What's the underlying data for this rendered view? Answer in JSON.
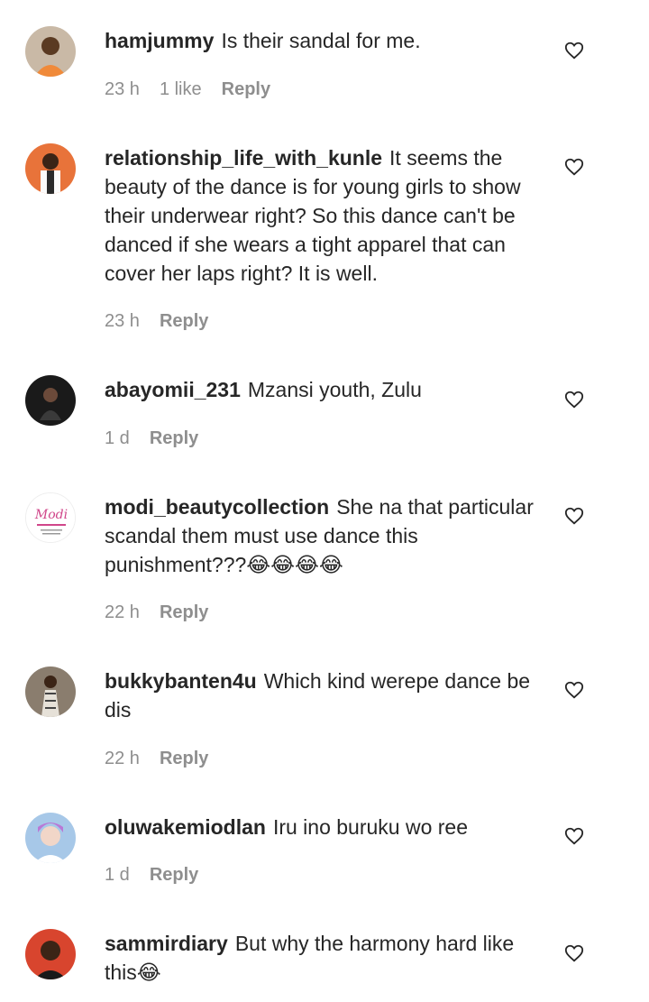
{
  "comments": [
    {
      "username": "hamjummy",
      "text": "Is their sandal for me.",
      "time": "23 h",
      "likes": "1 like",
      "reply_label": "Reply",
      "avatar_color": "#f08a3a",
      "heart_icon": "heart-outline-icon"
    },
    {
      "username": "relationship_life_with_kunle",
      "text": "It seems the beauty of the dance is for young girls to show their underwear right? So this dance can't be danced if she wears a tight apparel that can cover her laps right? It is well.",
      "time": "23 h",
      "likes": "",
      "reply_label": "Reply",
      "avatar_color": "#e8733a",
      "heart_icon": "heart-outline-icon"
    },
    {
      "username": "abayomii_231",
      "text": "Mzansi youth, Zulu",
      "time": "1 d",
      "likes": "",
      "reply_label": "Reply",
      "avatar_color": "#1a1a1a",
      "heart_icon": "heart-outline-icon"
    },
    {
      "username": "modi_beautycollection",
      "text": "She na that particular scandal them must use dance this punishment???😂😂😂😂",
      "time": "22 h",
      "likes": "",
      "reply_label": "Reply",
      "avatar_color": "#ffffff",
      "avatar_logo_text": "Modi",
      "heart_icon": "heart-outline-icon"
    },
    {
      "username": "bukkybanten4u",
      "text": "Which kind werepe dance be dis",
      "time": "22 h",
      "likes": "",
      "reply_label": "Reply",
      "avatar_color": "#8a7d6e",
      "heart_icon": "heart-outline-icon"
    },
    {
      "username": "oluwakemiodlan",
      "text": "Iru ino buruku wo ree",
      "time": "1 d",
      "likes": "",
      "reply_label": "Reply",
      "avatar_color": "#a7c8e8",
      "heart_icon": "heart-outline-icon"
    },
    {
      "username": "sammirdiary",
      "text": "But why the harmony hard like this😂",
      "time": "",
      "likes": "",
      "reply_label": "",
      "avatar_color": "#d8452e",
      "heart_icon": "heart-outline-icon"
    }
  ]
}
